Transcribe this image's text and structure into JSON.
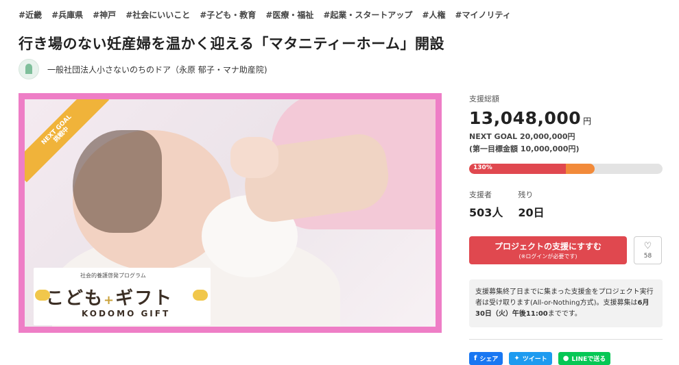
{
  "tags": [
    "#近畿",
    "#兵庫県",
    "#神戸",
    "#社会にいいこと",
    "#子ども・教育",
    "#医療・福祉",
    "#起業・スタートアップ",
    "#人権",
    "#マイノリティ"
  ],
  "project": {
    "title": "行き場のない妊産婦を温かく迎える「マタニティーホーム」開設",
    "owner": "一般社団法人小さないのちのドア（永原 郁子・マナ助産院)"
  },
  "hero": {
    "ribbon_line1": "NEXT GOAL",
    "ribbon_line2": "挑戦中",
    "logo_arc": "社会的養護啓発プログラム",
    "logo_main_1": "こども",
    "logo_main_2": "ギフト",
    "logo_en": "KODOMO GIFT"
  },
  "funding": {
    "total_label": "支援総額",
    "total": "13,048,000",
    "total_unit": "円",
    "next_goal": "NEXT GOAL 20,000,000円",
    "first_goal": "(第一目標金額 10,000,000円)",
    "percent_label": "130%",
    "progress_first_goal_fraction": 1.0,
    "progress_next_goal_fraction": 0.65,
    "supporters_label": "支援者",
    "supporters": "503人",
    "remaining_label": "残り",
    "remaining": "20日"
  },
  "actions": {
    "support_label": "プロジェクトの支援にすすむ",
    "support_sub": "(※ログインが必要です)",
    "favorite_count": "58"
  },
  "note": {
    "text1": "支援募集終了日までに集まった支援金をプロジェクト実行者は受け取ります(All-or-Nothing方式)。支援募集は",
    "deadline": "6月30日（火）午後11:00",
    "text2": "までです。"
  },
  "share": {
    "facebook": "シェア",
    "twitter": "ツイート",
    "line": "LINEで送る"
  },
  "colors": {
    "accent": "#e0484f",
    "next_goal_bar": "#f28a3a",
    "hero_border": "#ee7ec6",
    "ribbon": "#f0b33a"
  }
}
